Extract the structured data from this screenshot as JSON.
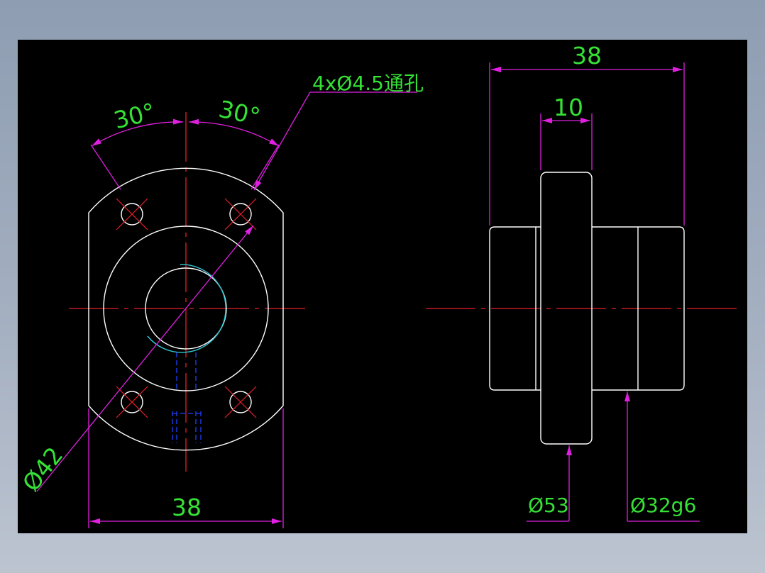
{
  "drawing": {
    "front_view": {
      "angle_left": "30°",
      "angle_right": "30°",
      "hole_callout": "4xØ4.5通孔",
      "pcd_label": "Ø42",
      "width_label": "38"
    },
    "side_view": {
      "overall_length_label": "38",
      "flange_thickness_label": "10",
      "flange_diameter_label": "Ø53",
      "body_diameter_label": "Ø32g6"
    }
  },
  "colors": {
    "background": "#000000",
    "outline": "#ffffff",
    "center_line": "#e8202a",
    "dimension": "#e020e0",
    "dimension_text": "#35e135",
    "hidden_line": "#2040ff",
    "thread_arc": "#30c8d8"
  }
}
